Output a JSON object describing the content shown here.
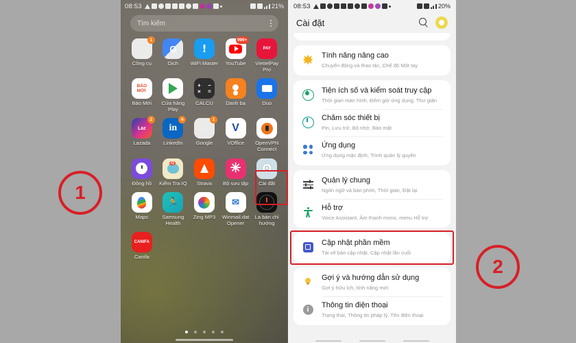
{
  "home": {
    "status_bar": {
      "time": "08:53",
      "battery": "21%",
      "icons": [
        "triangle-icon",
        "message-icon",
        "clock-icon",
        "download-icon",
        "upload-icon",
        "mail-icon",
        "do-not-disturb-icon",
        "app-icon",
        "pink-dot-icon",
        "purple-dot-icon",
        "image-icon",
        "dot-icon",
        "mute-icon",
        "wifi-icon",
        "signal-icon"
      ]
    },
    "search": {
      "placeholder": "Tìm kiếm",
      "menu": "kebab-menu"
    },
    "apps": [
      {
        "label": "Công cụ",
        "type": "folder",
        "badge": "1"
      },
      {
        "label": "Dịch",
        "type": "translate",
        "badge": ""
      },
      {
        "label": "WiFi Master",
        "type": "wifi",
        "badge": ""
      },
      {
        "label": "YouTube",
        "type": "youtube",
        "badge": "999+"
      },
      {
        "label": "ViettelPay Pro",
        "type": "viettelpay",
        "badge": ""
      },
      {
        "label": "Báo Mới",
        "type": "baomoi",
        "badge": ""
      },
      {
        "label": "Cửa hàng Play",
        "type": "play",
        "badge": ""
      },
      {
        "label": "CALCU",
        "type": "calcu",
        "badge": ""
      },
      {
        "label": "Danh bạ",
        "type": "contacts",
        "badge": ""
      },
      {
        "label": "Duo",
        "type": "duo",
        "badge": ""
      },
      {
        "label": "Lazada",
        "type": "lazada",
        "badge": "2"
      },
      {
        "label": "LinkedIn",
        "type": "linkedin",
        "badge": "6"
      },
      {
        "label": "Google",
        "type": "folder-google",
        "badge": "1"
      },
      {
        "label": "VOffice",
        "type": "voffice",
        "badge": ""
      },
      {
        "label": "OpenVPN Connect",
        "type": "openvpn",
        "badge": ""
      },
      {
        "label": "Đồng hồ",
        "type": "clock",
        "badge": ""
      },
      {
        "label": "Kiểm Tra IQ",
        "type": "iq",
        "badge": ""
      },
      {
        "label": "Strava",
        "type": "strava",
        "badge": ""
      },
      {
        "label": "Bộ sưu tập",
        "type": "gallery",
        "badge": ""
      },
      {
        "label": "Cài đặt",
        "type": "settings",
        "badge": ""
      },
      {
        "label": "Maps",
        "type": "maps",
        "badge": ""
      },
      {
        "label": "Samsung Health",
        "type": "health",
        "badge": ""
      },
      {
        "label": "Zing MP3",
        "type": "zing",
        "badge": ""
      },
      {
        "label": "Winmail.dat Opener",
        "type": "winmail",
        "badge": ""
      },
      {
        "label": "La bàn chỉ hướng",
        "type": "compass",
        "badge": ""
      },
      {
        "label": "Canifa",
        "type": "canifa",
        "badge": ""
      }
    ],
    "page_dots": {
      "count": 5,
      "active": 1
    }
  },
  "settings": {
    "status_bar": {
      "time": "08:53",
      "battery": "20%"
    },
    "header": {
      "title": "Cài đặt",
      "search_icon": "search-icon",
      "avatar": "profile-avatar"
    },
    "items": [
      {
        "title": "Tính năng nâng cao",
        "sub": "Chuyển động và thao tác, Chế độ Một tay",
        "icon": "star-icon"
      },
      {
        "title": "Tiện ích số và kiểm soát truy cập",
        "sub": "Thời gian màn hình, Đếm giờ ứng dụng, Thư giãn",
        "icon": "digital-wellbeing-icon"
      },
      {
        "title": "Chăm sóc thiết bị",
        "sub": "Pin, Lưu trữ, Bộ nhớ, Bảo mật",
        "icon": "battery-icon"
      },
      {
        "title": "Ứng dụng",
        "sub": "Ứng dụng mặc định, Trình quản lý quyền",
        "icon": "apps-icon"
      },
      {
        "title": "Quản lý chung",
        "sub": "Ngôn ngữ và bàn phím, Thời gian, Đặt lại",
        "icon": "sliders-icon"
      },
      {
        "title": "Hỗ trợ",
        "sub": "Voice Assistant, Âm thanh mono, menu Hỗ trợ",
        "icon": "accessibility-icon"
      },
      {
        "title": "Cập nhật phần mềm",
        "sub": "Tải về bản cập nhật, Cập nhật lần cuối",
        "icon": "software-update-icon"
      },
      {
        "title": "Gợi ý và hướng dẫn sử dụng",
        "sub": "Gợi ý hữu ích, tính năng mới",
        "icon": "bulb-icon"
      },
      {
        "title": "Thông tin điện thoại",
        "sub": "Trạng thái, Thông tin pháp lý, Tên điện thoại",
        "icon": "info-icon"
      }
    ]
  },
  "annotations": {
    "marker_1": "1",
    "marker_2": "2",
    "highlight_color": "#d81f26"
  }
}
